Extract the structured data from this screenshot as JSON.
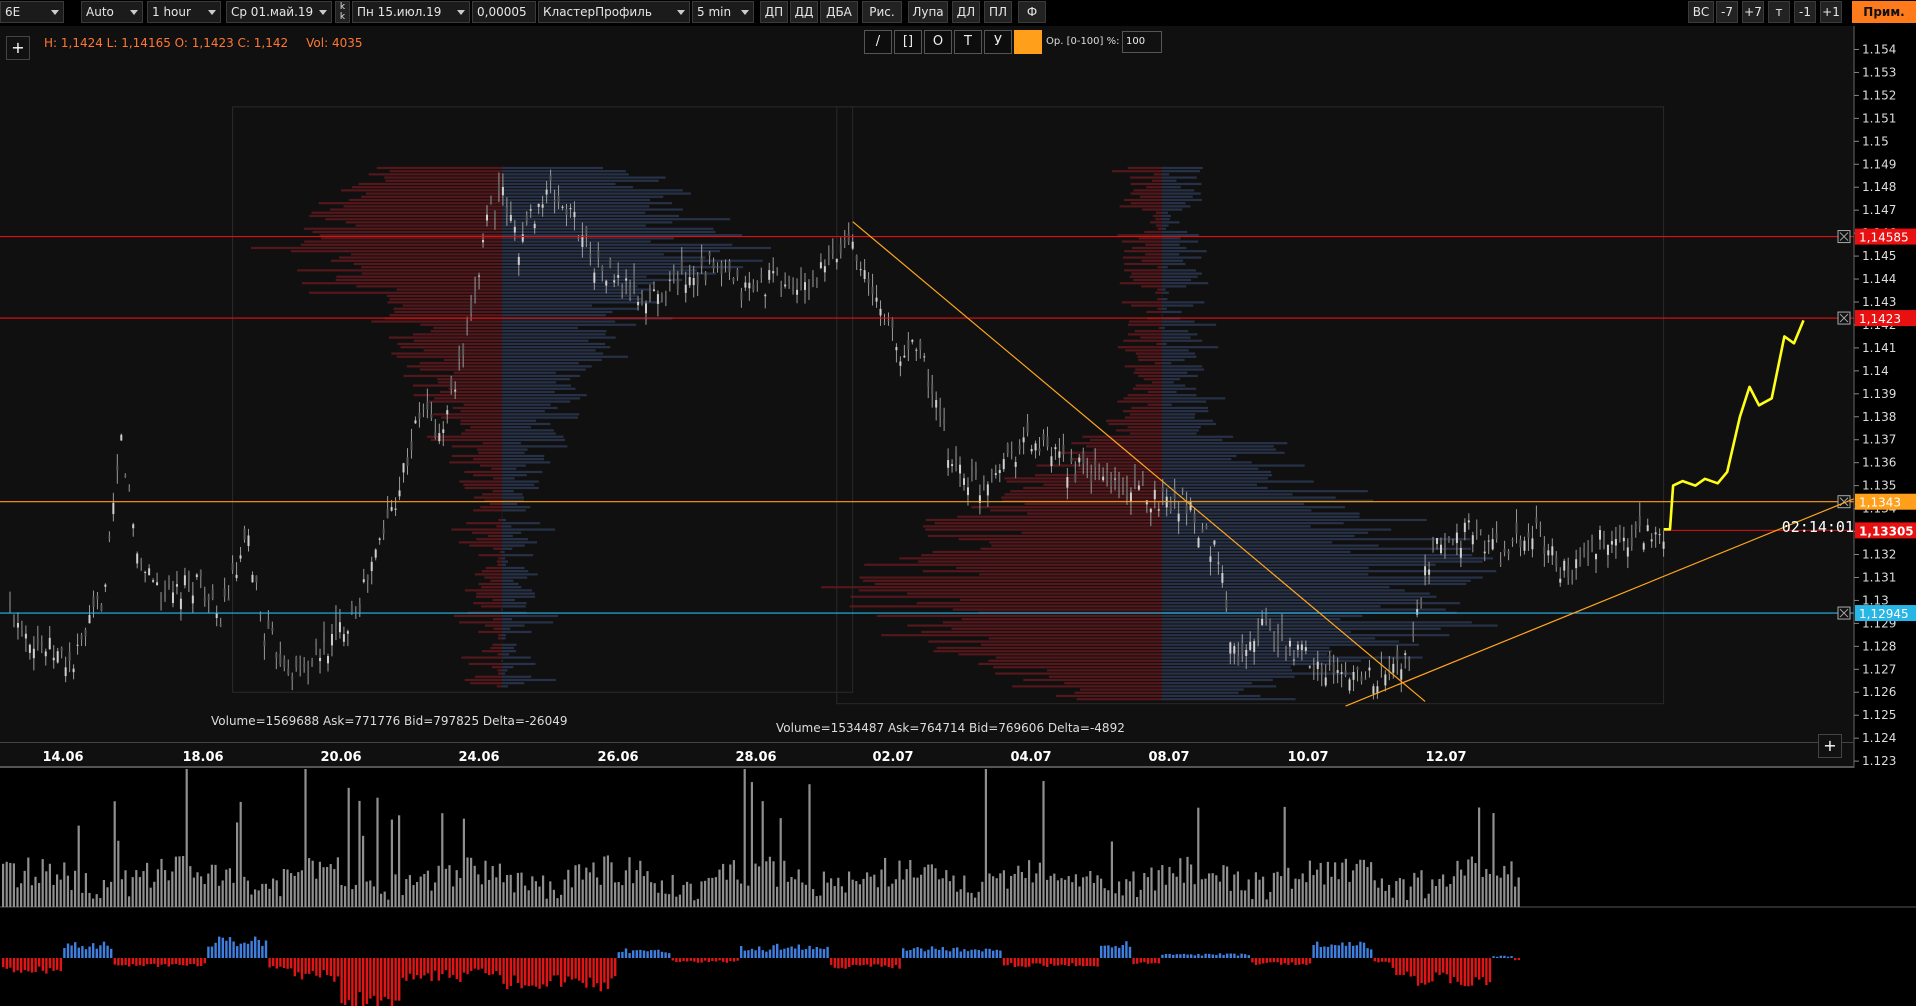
{
  "toolbar": {
    "symbol": "6E",
    "scale": "Auto",
    "timeframe": "1 hour",
    "date_from": "Ср 01.май.19",
    "date_to": "Пн 15.июл.19",
    "tick": "0,00005",
    "indicator": "КластерПрофиль",
    "profile_tf": "5 min",
    "buttons": [
      "ДП",
      "ДД",
      "ДБА",
      "Рис.",
      "Лупа",
      "ДЛ",
      "ПЛ",
      "Ф"
    ],
    "right_buttons": [
      "ВС",
      "-7",
      "+7",
      "т",
      "-1",
      "+1"
    ],
    "prim_label": "Прим."
  },
  "ohlc": {
    "text": "H: 1,1424  L: 1,14165  O: 1,1423  C: 1,142",
    "vol": "Vol: 4035"
  },
  "draw_tools": {
    "buttons": [
      "/",
      "[]",
      "О",
      "Т",
      "У"
    ],
    "op_label": "Ор. [0-100] %:",
    "op_value": "100"
  },
  "timer": "02:14:01",
  "profiles": [
    {
      "stats": "Volume=1569688  Ask=771776  Bid=797825  Delta=-26049"
    },
    {
      "stats": "Volume=1534487  Ask=764714  Bid=769606  Delta=-4892"
    }
  ],
  "chart_data": {
    "type": "candlestick",
    "x_labels": [
      "14.06",
      "18.06",
      "20.06",
      "24.06",
      "26.06",
      "28.06",
      "02.07",
      "04.07",
      "08.07",
      "10.07",
      "12.07"
    ],
    "y_ticks": [
      "1.154",
      "1.153",
      "1.152",
      "1.151",
      "1.15",
      "1.149",
      "1.148",
      "1.147",
      "1.146",
      "1.145",
      "1.144",
      "1.143",
      "1.142",
      "1.141",
      "1.14",
      "1.139",
      "1.138",
      "1.137",
      "1.136",
      "1.135",
      "1.134",
      "1.133",
      "1.132",
      "1.131",
      "1.13",
      "1.129",
      "1.128",
      "1.127",
      "1.126",
      "1.125",
      "1.124",
      "1.123"
    ],
    "y_range": [
      1.1227,
      1.1545
    ],
    "levels": [
      {
        "label": "1,14585",
        "value": 1.14585,
        "color": "#e01010"
      },
      {
        "label": "1,1423",
        "value": 1.1423,
        "color": "#e01010"
      },
      {
        "label": "1,1343",
        "value": 1.1343,
        "color": "#ff9f1a"
      },
      {
        "label": "1,13305",
        "value": 1.13305,
        "color": "#e01010",
        "current": true
      },
      {
        "label": "1,12945",
        "value": 1.12945,
        "color": "#27b6e6"
      }
    ],
    "price_path": [
      [
        0,
        1.1295
      ],
      [
        2,
        1.128
      ],
      [
        4,
        1.1272
      ],
      [
        6,
        1.1305
      ],
      [
        7,
        1.137
      ],
      [
        8,
        1.132
      ],
      [
        10,
        1.13
      ],
      [
        12,
        1.131
      ],
      [
        13,
        1.129
      ],
      [
        15,
        1.1325
      ],
      [
        16,
        1.1285
      ],
      [
        18,
        1.1268
      ],
      [
        20,
        1.128
      ],
      [
        22,
        1.13
      ],
      [
        24,
        1.134
      ],
      [
        26,
        1.1385
      ],
      [
        27,
        1.137
      ],
      [
        29,
        1.142
      ],
      [
        30,
        1.147
      ],
      [
        31,
        1.1475
      ],
      [
        32,
        1.1455
      ],
      [
        33,
        1.147
      ],
      [
        34,
        1.1478
      ],
      [
        35,
        1.147
      ],
      [
        36,
        1.146
      ],
      [
        37,
        1.1445
      ],
      [
        38,
        1.144
      ],
      [
        40,
        1.143
      ],
      [
        42,
        1.144
      ],
      [
        44,
        1.1445
      ],
      [
        46,
        1.1435
      ],
      [
        48,
        1.144
      ],
      [
        50,
        1.1435
      ],
      [
        52,
        1.145
      ],
      [
        53,
        1.146
      ],
      [
        54,
        1.1435
      ],
      [
        55,
        1.1425
      ],
      [
        56,
        1.1405
      ],
      [
        57,
        1.1415
      ],
      [
        58,
        1.139
      ],
      [
        59,
        1.1365
      ],
      [
        60,
        1.1355
      ],
      [
        61,
        1.135
      ],
      [
        62,
        1.136
      ],
      [
        63,
        1.1365
      ],
      [
        64,
        1.137
      ],
      [
        66,
        1.136
      ],
      [
        68,
        1.1355
      ],
      [
        70,
        1.135
      ],
      [
        72,
        1.1345
      ],
      [
        74,
        1.1343
      ],
      [
        75,
        1.133
      ],
      [
        76,
        1.132
      ],
      [
        77,
        1.1275
      ],
      [
        78,
        1.1285
      ],
      [
        79,
        1.129
      ],
      [
        80,
        1.128
      ],
      [
        82,
        1.1275
      ],
      [
        84,
        1.1265
      ],
      [
        85,
        1.127
      ],
      [
        86,
        1.1265
      ],
      [
        88,
        1.1275
      ],
      [
        89,
        1.131
      ],
      [
        90,
        1.1325
      ],
      [
        92,
        1.133
      ],
      [
        94,
        1.132
      ],
      [
        96,
        1.133
      ],
      [
        98,
        1.131
      ],
      [
        100,
        1.1325
      ],
      [
        102,
        1.1328
      ],
      [
        104,
        1.1331
      ]
    ],
    "forecast": [
      [
        104,
        1.1331
      ],
      [
        104.4,
        1.1331
      ],
      [
        104.6,
        1.135
      ],
      [
        105.2,
        1.1352
      ],
      [
        106,
        1.135
      ],
      [
        106.6,
        1.1353
      ],
      [
        107.4,
        1.1351
      ],
      [
        108,
        1.1356
      ],
      [
        108.8,
        1.138
      ],
      [
        109.4,
        1.1393
      ],
      [
        110,
        1.1385
      ],
      [
        110.8,
        1.1388
      ],
      [
        111.6,
        1.1415
      ],
      [
        112.2,
        1.1412
      ],
      [
        112.8,
        1.1422
      ]
    ],
    "trendlines": [
      {
        "from": [
          53,
          1.1465
        ],
        "to": [
          89,
          1.1256
        ]
      },
      {
        "from": [
          84,
          1.1254
        ],
        "to": [
          118,
          1.135
        ]
      }
    ],
    "profiles": [
      {
        "x_from": 14,
        "x_to": 53,
        "y_top": 1.1515,
        "y_bottom": 1.126,
        "poc": 1.1457
      },
      {
        "x_from": 52,
        "x_to": 104,
        "y_top": 1.1515,
        "y_bottom": 1.1255,
        "poc": 1.1305
      }
    ],
    "grid": false
  }
}
